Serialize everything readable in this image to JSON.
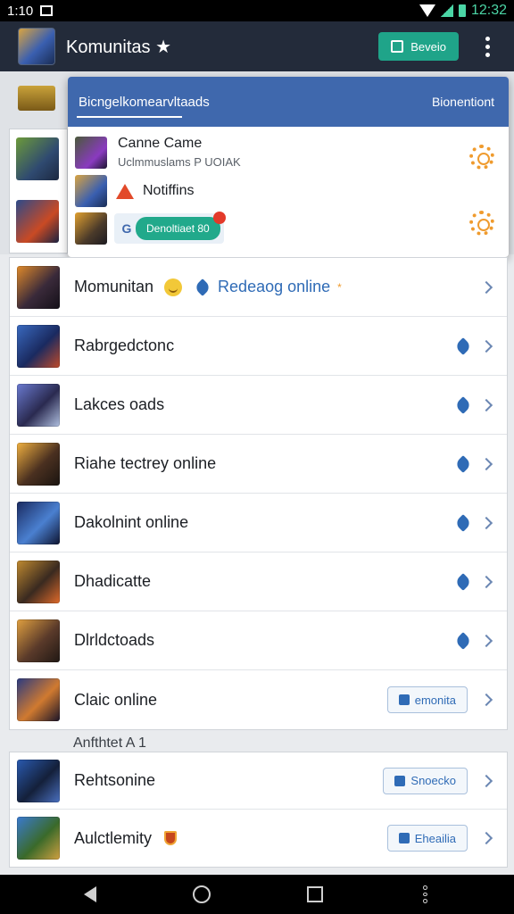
{
  "status_bar": {
    "time_left": "1:10",
    "time_right": "12:32"
  },
  "app_bar": {
    "title": "Komunitas",
    "title_star": "★",
    "new_button": "Beveio"
  },
  "popup": {
    "header_title": "Bicngelkomearvltaads",
    "header_right": "Bionentiont",
    "items": [
      {
        "title": "Canne Came",
        "subtitle": "Uclmmuslams P UOIAK"
      },
      {
        "title": "Notiffins"
      },
      {
        "action_glyph": "G",
        "action_label": "Denoltiaet 80"
      }
    ]
  },
  "list": [
    {
      "label": "Momunitan",
      "status": "Redeaog online",
      "status_star": "*"
    },
    {
      "label": "Rabrgedctonc"
    },
    {
      "label": "Lakces oads"
    },
    {
      "label": "Riahe tectrey online"
    },
    {
      "label": "Dakolnint online"
    },
    {
      "label": "Dhadicatte"
    },
    {
      "label": "Dlrldctoads"
    },
    {
      "label": "Claic online",
      "tag": "emonita"
    }
  ],
  "section_label": "Anfthtet  A 1",
  "list2": [
    {
      "label": "Rehtsonine",
      "tag": "Snoecko"
    },
    {
      "label": "Aulctlemity",
      "tag": "Eheailia"
    }
  ],
  "colors": {
    "app_bar": "#232b3a",
    "popup_header": "#3f68ad",
    "accent_green": "#1fa489",
    "link_blue": "#2f6bb6"
  }
}
